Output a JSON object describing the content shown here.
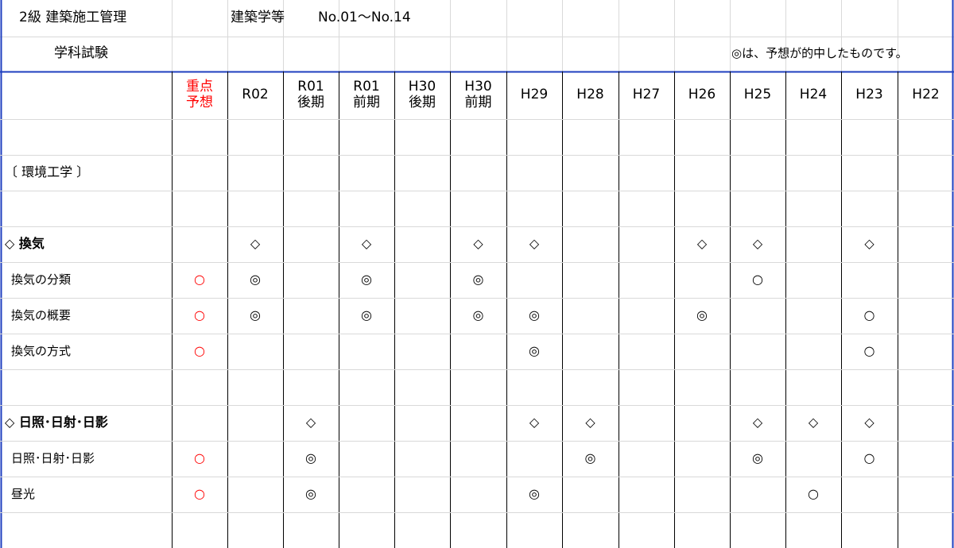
{
  "title": {
    "grade_title": "2級  建築施工管理",
    "subject": "建築学等",
    "range": "No.01～No.14",
    "exam_type": "学科試験",
    "note": "◎は、予想が的中したものです。"
  },
  "columns": [
    {
      "id": "forecast",
      "label": "重点\n予想",
      "color": "#ff0000"
    },
    {
      "id": "R02",
      "label": "R02"
    },
    {
      "id": "R01b",
      "label": "R01\n後期"
    },
    {
      "id": "R01a",
      "label": "R01\n前期"
    },
    {
      "id": "H30b",
      "label": "H30\n後期"
    },
    {
      "id": "H30a",
      "label": "H30\n前期"
    },
    {
      "id": "H29",
      "label": "H29"
    },
    {
      "id": "H28",
      "label": "H28"
    },
    {
      "id": "H27",
      "label": "H27"
    },
    {
      "id": "H26",
      "label": "H26"
    },
    {
      "id": "H25",
      "label": "H25"
    },
    {
      "id": "H24",
      "label": "H24"
    },
    {
      "id": "H23",
      "label": "H23"
    },
    {
      "id": "H22",
      "label": "H22"
    }
  ],
  "rows": [
    {
      "label": "",
      "marks": [
        "",
        "",
        "",
        "",
        "",
        "",
        "",
        "",
        "",
        "",
        "",
        "",
        "",
        ""
      ]
    },
    {
      "label": "〔 環境工学 〕",
      "kind": "section",
      "marks": [
        "",
        "",
        "",
        "",
        "",
        "",
        "",
        "",
        "",
        "",
        "",
        "",
        "",
        ""
      ]
    },
    {
      "label": "",
      "marks": [
        "",
        "",
        "",
        "",
        "",
        "",
        "",
        "",
        "",
        "",
        "",
        "",
        "",
        ""
      ]
    },
    {
      "label": "◇ 換気",
      "kind": "topic",
      "marks": [
        "",
        "◇",
        "",
        "◇",
        "",
        "◇",
        "◇",
        "",
        "",
        "◇",
        "◇",
        "",
        "◇",
        ""
      ]
    },
    {
      "label": "換気の分類",
      "kind": "item",
      "marks": [
        "○",
        "◎",
        "",
        "◎",
        "",
        "◎",
        "",
        "",
        "",
        "",
        "○",
        "",
        "",
        ""
      ]
    },
    {
      "label": "換気の概要",
      "kind": "item",
      "marks": [
        "○",
        "◎",
        "",
        "◎",
        "",
        "◎",
        "◎",
        "",
        "",
        "◎",
        "",
        "",
        "○",
        ""
      ]
    },
    {
      "label": "換気の方式",
      "kind": "item",
      "marks": [
        "○",
        "",
        "",
        "",
        "",
        "",
        "◎",
        "",
        "",
        "",
        "",
        "",
        "○",
        ""
      ]
    },
    {
      "label": "",
      "marks": [
        "",
        "",
        "",
        "",
        "",
        "",
        "",
        "",
        "",
        "",
        "",
        "",
        "",
        ""
      ]
    },
    {
      "label": "◇ 日照･日射･日影",
      "kind": "topic",
      "marks": [
        "",
        "",
        "◇",
        "",
        "",
        "",
        "◇",
        "◇",
        "",
        "",
        "◇",
        "◇",
        "◇",
        ""
      ]
    },
    {
      "label": "日照･日射･日影",
      "kind": "item",
      "marks": [
        "○",
        "",
        "◎",
        "",
        "",
        "",
        "",
        "◎",
        "",
        "",
        "◎",
        "",
        "○",
        ""
      ]
    },
    {
      "label": "昼光",
      "kind": "item",
      "marks": [
        "○",
        "",
        "◎",
        "",
        "",
        "",
        "◎",
        "",
        "",
        "",
        "",
        "○",
        "",
        ""
      ]
    },
    {
      "label": "",
      "marks": [
        "",
        "",
        "",
        "",
        "",
        "",
        "",
        "",
        "",
        "",
        "",
        "",
        "",
        ""
      ]
    }
  ],
  "colors": {
    "grid_blue": "#1f3fbf",
    "grid_light": "#d9d9d9",
    "forecast_red": "#ff0000"
  }
}
